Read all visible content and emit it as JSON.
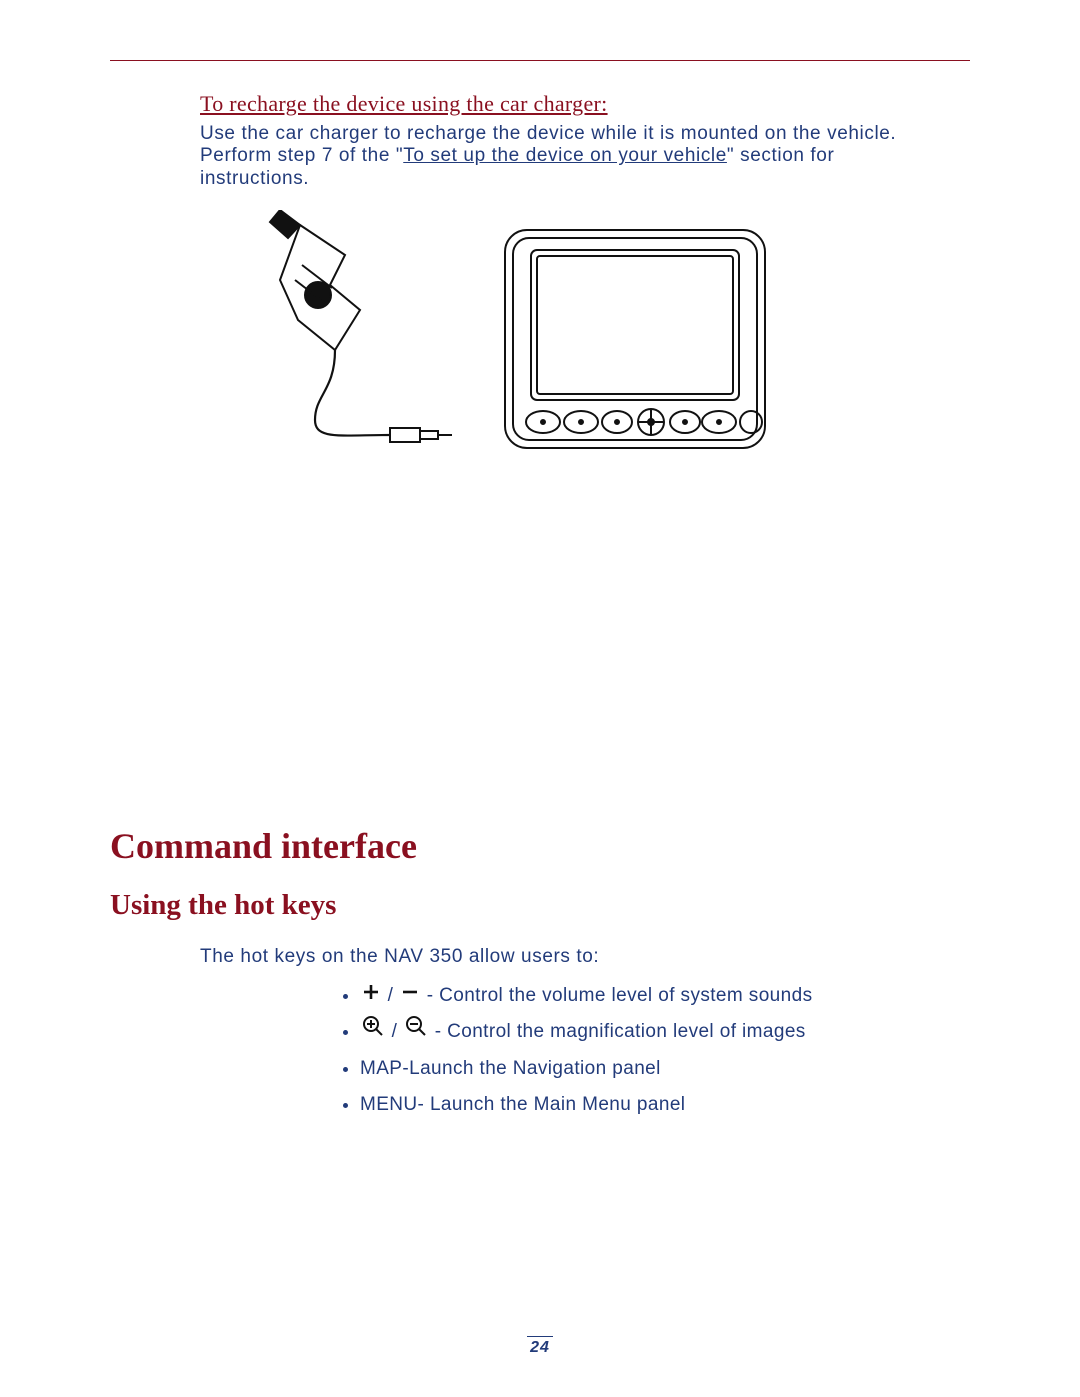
{
  "section_sub": "To recharge the device using the car charger:",
  "paragraph": {
    "pre": "Use the car charger to recharge the device while it is mounted on the vehicle. Perform step 7 of the \"",
    "link": "To set up the device on your vehicle",
    "post": "\" section for instructions."
  },
  "figures": {
    "charger_alt": "car-charger-illustration",
    "device_alt": "device-front-illustration"
  },
  "heading1": "Command interface",
  "heading2": "Using the hot keys",
  "intro": "The hot keys on the NAV 350 allow users to:",
  "bullets": {
    "b1": {
      "icon_plus": "plus-icon",
      "sep": " / ",
      "icon_minus": "minus-icon",
      "text": " - Control the volume level of system sounds"
    },
    "b2": {
      "icon_zoom_in": "zoom-in-icon",
      "sep": " / ",
      "icon_zoom_out": "zoom-out-icon",
      "text": " - Control the magnification level of images"
    },
    "b3": {
      "text": "MAP-Launch the Navigation panel"
    },
    "b4": {
      "text": "MENU- Launch the Main Menu panel"
    }
  },
  "page_number": "24"
}
